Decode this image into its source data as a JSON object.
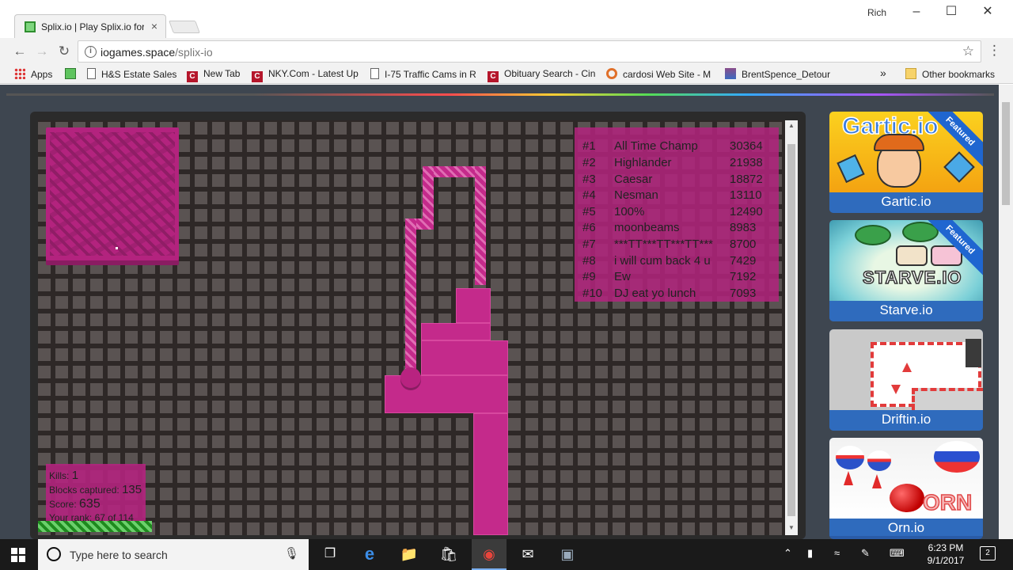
{
  "browser": {
    "tab_title": "Splix.io | Play Splix.io for",
    "tab_close": "×",
    "user": "Rich",
    "url_host": "iogames.space",
    "url_path": "/splix-io",
    "more_bookmarks": "»"
  },
  "bookmarks": [
    {
      "label": "Apps",
      "icon": "apps-icon"
    },
    {
      "label": "",
      "icon": "green-square-icon"
    },
    {
      "label": "H&S Estate Sales",
      "icon": "page-icon"
    },
    {
      "label": "New Tab",
      "icon": "c-logo-icon"
    },
    {
      "label": "NKY.Com - Latest Up",
      "icon": "c-logo-icon"
    },
    {
      "label": "I-75 Traffic Cams in R",
      "icon": "page-icon"
    },
    {
      "label": "Obituary Search - Cin",
      "icon": "c-logo-icon"
    },
    {
      "label": "cardosi Web Site - M",
      "icon": "ring-icon"
    },
    {
      "label": "BrentSpence_Detour",
      "icon": "image-icon"
    },
    {
      "label": "Other bookmarks",
      "icon": "folder-icon"
    }
  ],
  "leaderboard": [
    {
      "rank": "#1",
      "name": "All Time Champ",
      "score": "30364"
    },
    {
      "rank": "#2",
      "name": "Highlander",
      "score": "21938"
    },
    {
      "rank": "#3",
      "name": "Caesar",
      "score": "18872"
    },
    {
      "rank": "#4",
      "name": "Nesman",
      "score": "13110"
    },
    {
      "rank": "#5",
      "name": "100%",
      "score": "12490"
    },
    {
      "rank": "#6",
      "name": "moonbeams",
      "score": "8983"
    },
    {
      "rank": "#7",
      "name": "***TT***TT***TT***",
      "score": "8700"
    },
    {
      "rank": "#8",
      "name": "i will cum back 4 u",
      "score": "7429"
    },
    {
      "rank": "#9",
      "name": "Ew",
      "score": "7192"
    },
    {
      "rank": "#10",
      "name": "DJ eat yo lunch",
      "score": "7093"
    }
  ],
  "stats": {
    "kills_label": "Kills:",
    "kills": "1",
    "blocks_label": "Blocks captured:",
    "blocks": "135",
    "score_label": "Score:",
    "score": "635",
    "rank_label": "Your rank:",
    "rank": "67 of 114"
  },
  "featured_games": [
    {
      "name": "Gartic.io",
      "ribbon": "Featured",
      "art_word": "Gartic.io"
    },
    {
      "name": "Starve.io",
      "ribbon": "Featured",
      "art_word": "STARVE.IO"
    },
    {
      "name": "Driftin.io",
      "ribbon": "",
      "art_word": ""
    },
    {
      "name": "Orn.io",
      "ribbon": "",
      "art_word": "ORN"
    }
  ],
  "taskbar": {
    "search_placeholder": "Type here to search",
    "time": "6:23 PM",
    "date": "9/1/2017",
    "notifications": "2"
  },
  "colors": {
    "player": "#c42a8b",
    "board": "#4a4342",
    "tile_label": "#2f6bbd"
  }
}
